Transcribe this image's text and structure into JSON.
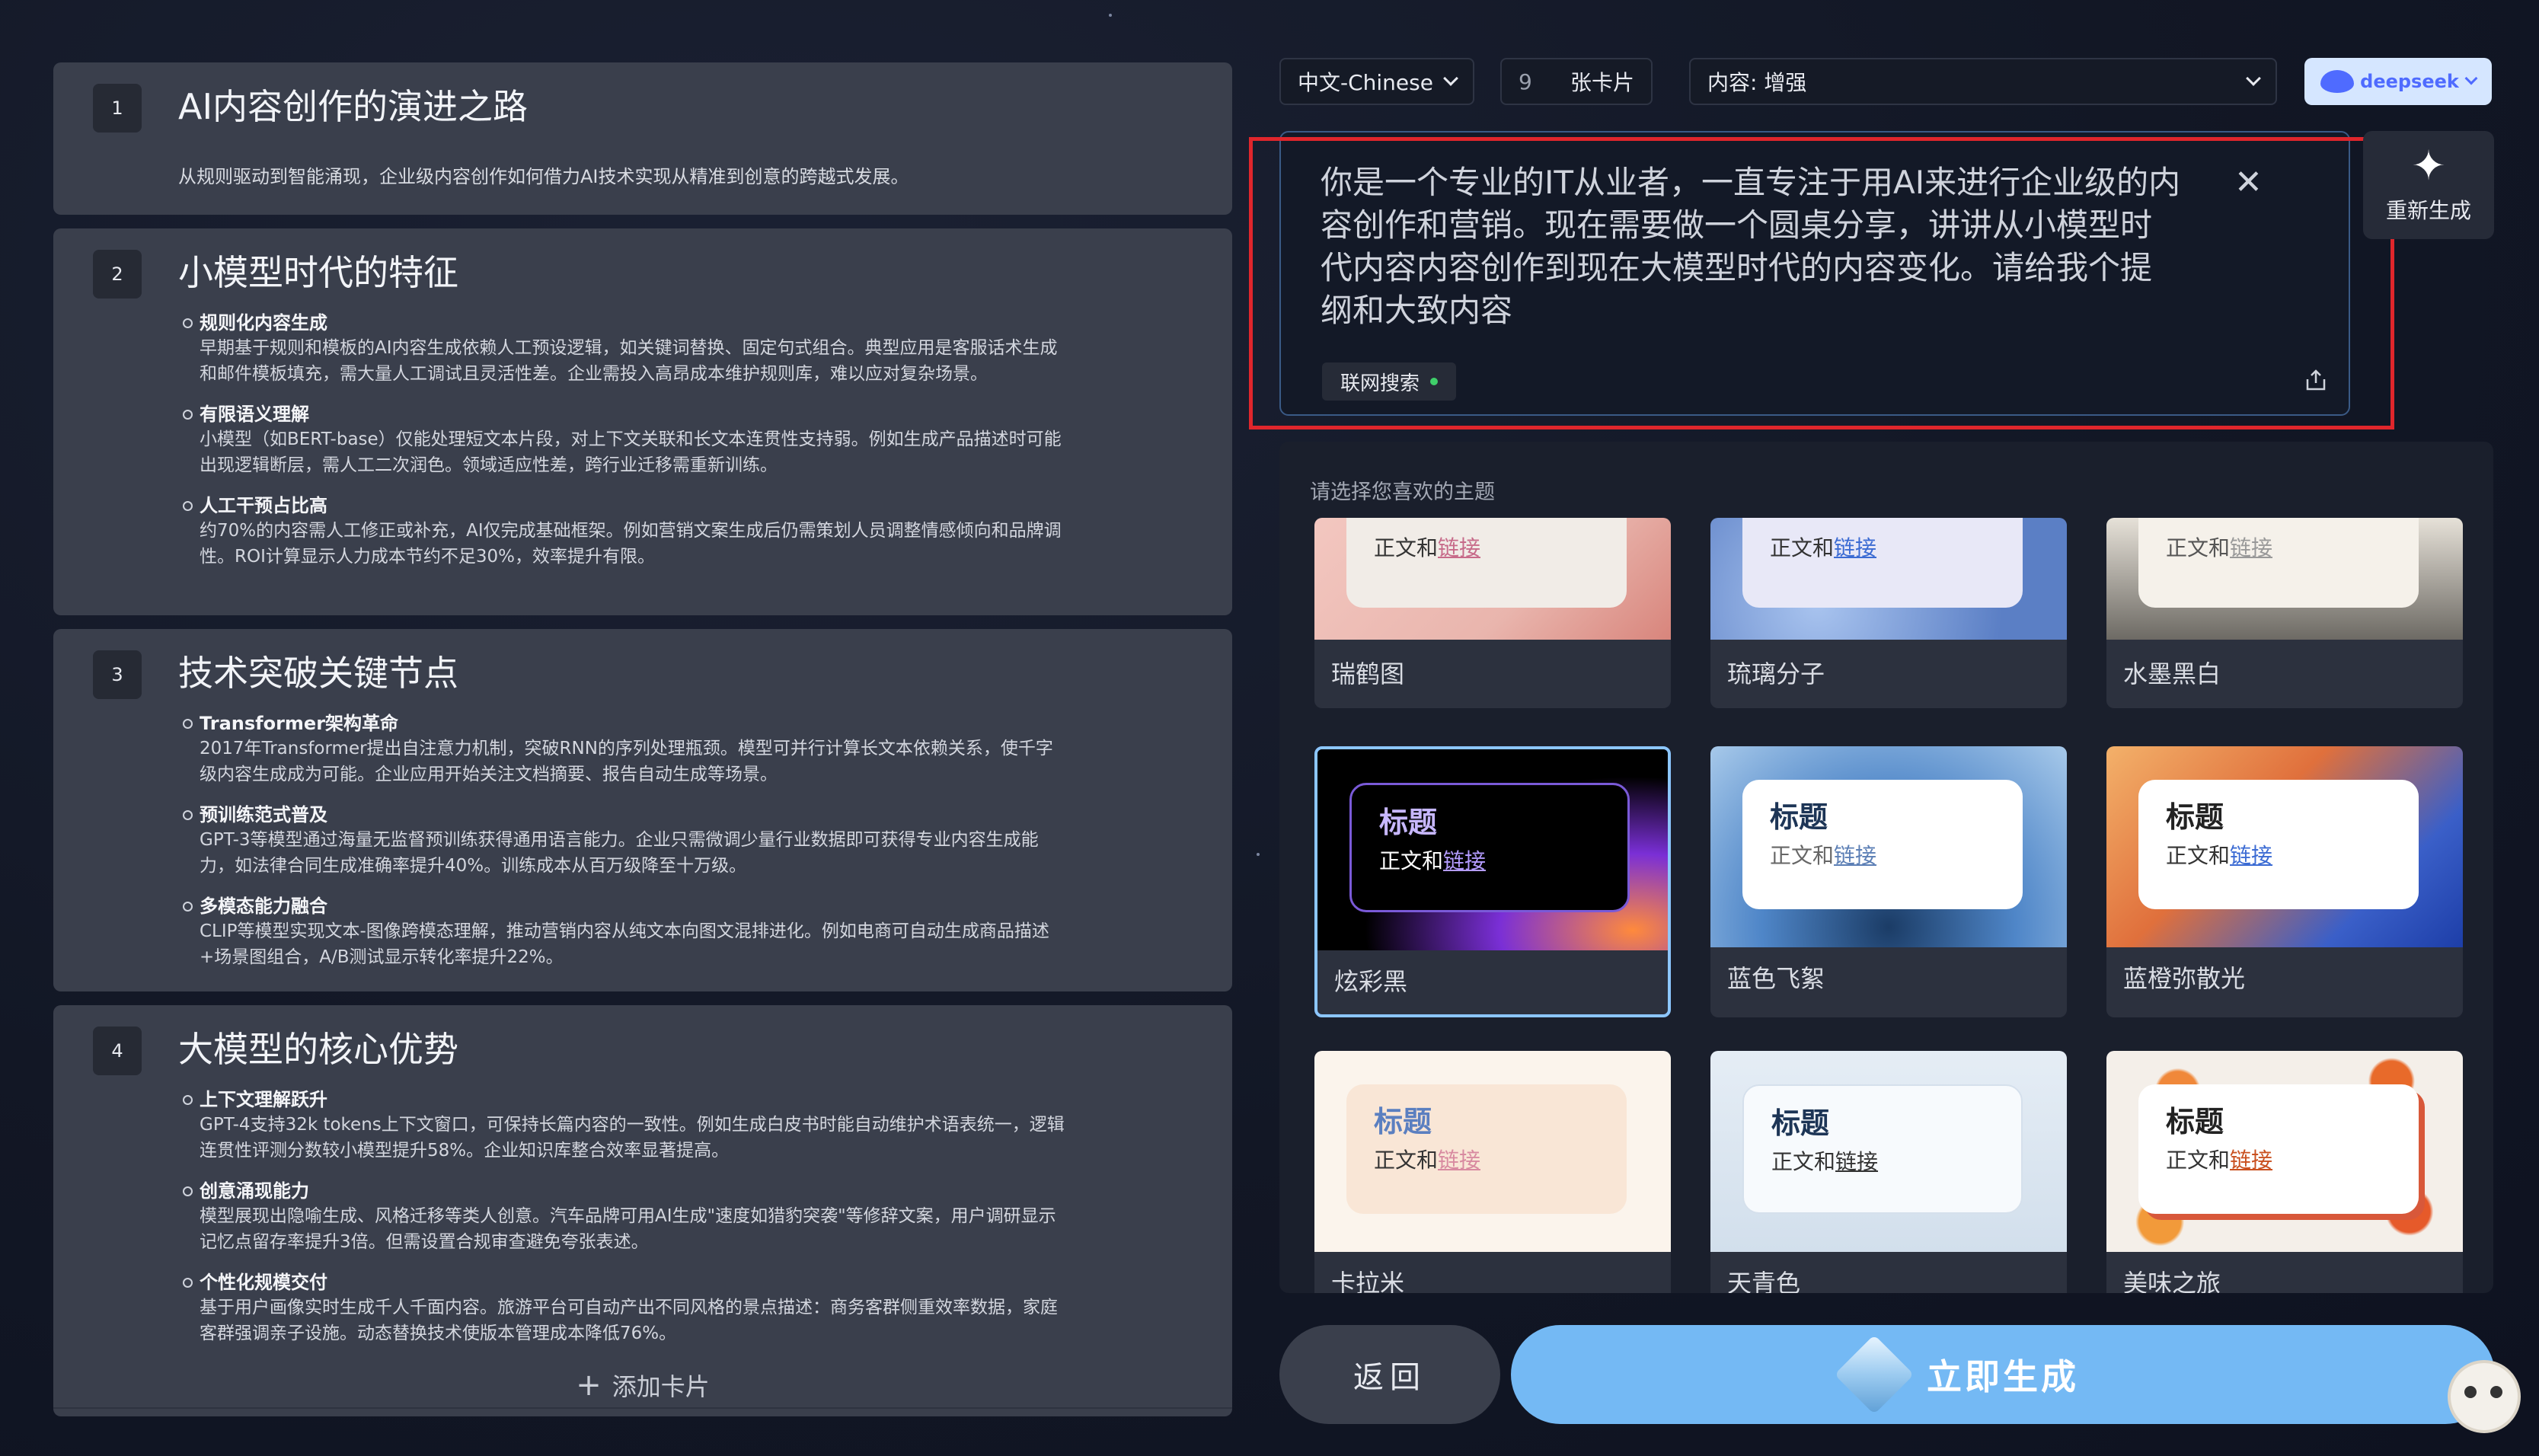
{
  "outline": {
    "cards": [
      {
        "num": "1",
        "title": "AI内容创作的演进之路",
        "subtitle": "从规则驱动到智能涌现，企业级内容创作如何借力AI技术实现从精准到创意的跨越式发展。"
      },
      {
        "num": "2",
        "title": "小模型时代的特征",
        "points": [
          {
            "h": "规则化内容生成",
            "d": "早期基于规则和模板的AI内容生成依赖人工预设逻辑，如关键词替换、固定句式组合。典型应用是客服话术生成和邮件模板填充，需大量人工调试且灵活性差。企业需投入高昂成本维护规则库，难以应对复杂场景。"
          },
          {
            "h": "有限语义理解",
            "d": "小模型（如BERT-base）仅能处理短文本片段，对上下文关联和长文本连贯性支持弱。例如生成产品描述时可能出现逻辑断层，需人工二次润色。领域适应性差，跨行业迁移需重新训练。"
          },
          {
            "h": "人工干预占比高",
            "d": "约70%的内容需人工修正或补充，AI仅完成基础框架。例如营销文案生成后仍需策划人员调整情感倾向和品牌调性。ROI计算显示人力成本节约不足30%，效率提升有限。"
          }
        ]
      },
      {
        "num": "3",
        "title": "技术突破关键节点",
        "points": [
          {
            "h": "Transformer架构革命",
            "d": "2017年Transformer提出自注意力机制，突破RNN的序列处理瓶颈。模型可并行计算长文本依赖关系，使千字级内容生成成为可能。企业应用开始关注文档摘要、报告自动生成等场景。"
          },
          {
            "h": "预训练范式普及",
            "d": "GPT-3等模型通过海量无监督预训练获得通用语言能力。企业只需微调少量行业数据即可获得专业内容生成能力，如法律合同生成准确率提升40%。训练成本从百万级降至十万级。"
          },
          {
            "h": "多模态能力融合",
            "d": "CLIP等模型实现文本-图像跨模态理解，推动营销内容从纯文本向图文混排进化。例如电商可自动生成商品描述+场景图组合，A/B测试显示转化率提升22%。"
          }
        ]
      },
      {
        "num": "4",
        "title": "大模型的核心优势",
        "points": [
          {
            "h": "上下文理解跃升",
            "d": "GPT-4支持32k tokens上下文窗口，可保持长篇内容的一致性。例如生成白皮书时能自动维护术语表统一，逻辑连贯性评测分数较小模型提升58%。企业知识库整合效率显著提高。"
          },
          {
            "h": "创意涌现能力",
            "d": "模型展现出隐喻生成、风格迁移等类人创意。汽车品牌可用AI生成\"速度如猎豹突袭\"等修辞文案，用户调研显示记忆点留存率提升3倍。但需设置合规审查避免夸张表述。"
          },
          {
            "h": "个性化规模交付",
            "d": "基于用户画像实时生成千人千面内容。旅游平台可自动产出不同风格的景点描述：商务客群侧重效率数据，家庭客群强调亲子设施。动态替换技术使版本管理成本降低76%。"
          }
        ]
      }
    ],
    "add_card_label": "添加卡片"
  },
  "toolbar": {
    "language": "中文-Chinese",
    "card_count": "9",
    "card_unit": "张卡片",
    "content_mode": "内容: 增强",
    "model": "deepseek"
  },
  "prompt": {
    "text": "你是一个专业的IT从业者，一直专注于用AI来进行企业级的内容创作和营销。现在需要做一个圆桌分享，讲讲从小模型时代内容内容创作到现在大模型时代的内容变化。请给我个提纲和大致内容",
    "web_search": "联网搜索",
    "regenerate": "重新生成"
  },
  "themes": {
    "hint": "请选择您喜欢的主题",
    "sample_title": "标题",
    "sample_body": "正文和",
    "sample_link": "链接",
    "items": [
      {
        "name": "瑞鹤图",
        "selected": false
      },
      {
        "name": "琉璃分子",
        "selected": false
      },
      {
        "name": "水墨黑白",
        "selected": false
      },
      {
        "name": "炫彩黑",
        "selected": true
      },
      {
        "name": "蓝色飞絮",
        "selected": false
      },
      {
        "name": "蓝橙弥散光",
        "selected": false
      },
      {
        "name": "卡拉米",
        "selected": false
      },
      {
        "name": "天青色",
        "selected": false
      },
      {
        "name": "美味之旅",
        "selected": false
      }
    ]
  },
  "actions": {
    "back": "返回",
    "generate": "立即生成"
  },
  "colors": {
    "generate_button": "#74b9f4",
    "selected_theme_border": "#8cc6ff",
    "highlight_box": "#e0262c"
  }
}
